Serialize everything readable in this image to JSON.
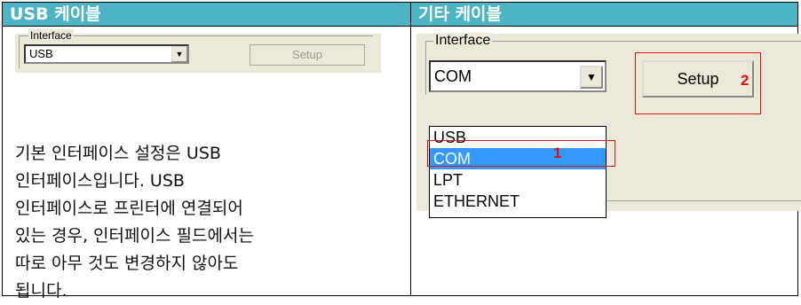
{
  "header": {
    "usb_title": "USB 케이블",
    "other_title": "기타 케이블"
  },
  "usb_panel": {
    "interface_label": "Interface",
    "selected": "USB",
    "setup_label": "Setup"
  },
  "description": {
    "lines": [
      "기본 인터페이스 설정은 USB",
      "인터페이스입니다. USB",
      "인터페이스로 프린터에 연결되어",
      "있는 경우, 인터페이스 필드에서는",
      "따로 아무 것도 변경하지 않아도",
      "됩니다."
    ]
  },
  "com_panel": {
    "interface_label": "Interface",
    "selected": "COM",
    "setup_label": "Setup",
    "options": [
      "USB",
      "COM",
      "LPT",
      "ETHERNET"
    ],
    "callout_1": "1",
    "callout_2": "2"
  },
  "colors": {
    "header_bg": "#4cb4c4",
    "highlight": "#3399ff",
    "callout": "#e01010"
  }
}
